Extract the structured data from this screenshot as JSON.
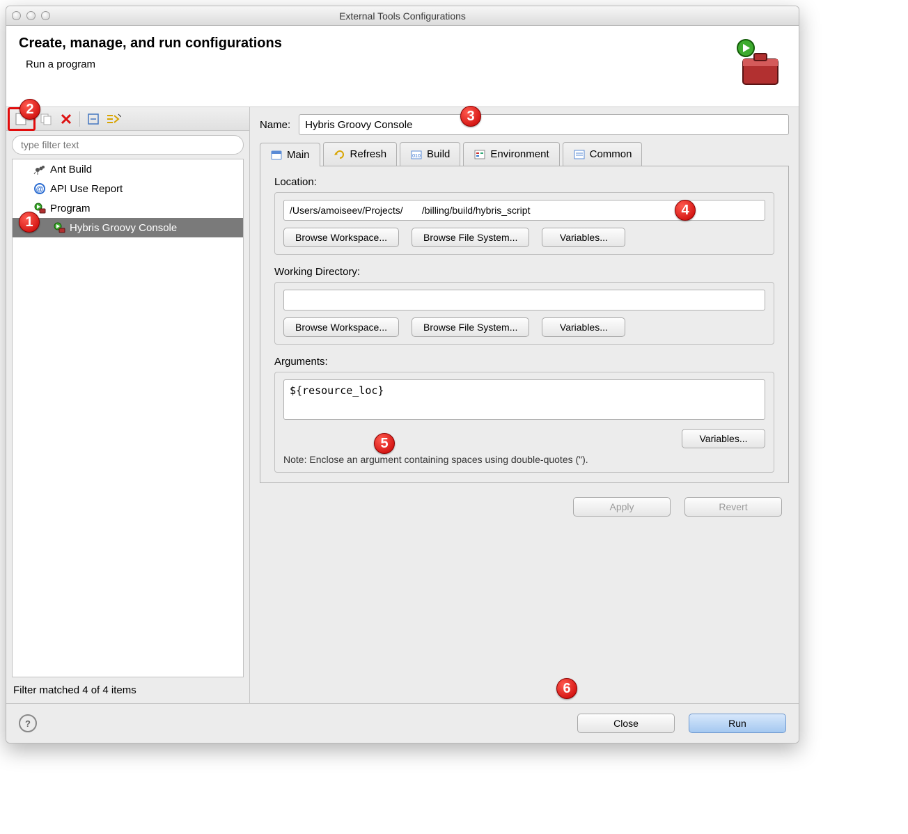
{
  "window": {
    "title": "External Tools Configurations"
  },
  "banner": {
    "heading": "Create, manage, and run configurations",
    "subheading": "Run a program"
  },
  "filter": {
    "placeholder": "type filter text"
  },
  "tree": {
    "items": [
      {
        "label": "Ant Build",
        "icon": "ant"
      },
      {
        "label": "API Use Report",
        "icon": "at"
      },
      {
        "label": "Program",
        "icon": "program",
        "children": [
          {
            "label": "Hybris Groovy Console",
            "icon": "program",
            "selected": true
          }
        ]
      }
    ]
  },
  "filter_status": "Filter matched 4 of 4 items",
  "form": {
    "name_label": "Name:",
    "name_value": "Hybris Groovy Console"
  },
  "tabs": [
    {
      "label": "Main",
      "active": true
    },
    {
      "label": "Refresh"
    },
    {
      "label": "Build"
    },
    {
      "label": "Environment"
    },
    {
      "label": "Common"
    }
  ],
  "main_tab": {
    "location": {
      "label": "Location:",
      "value": "/Users/amoiseev/Projects/       /billing/build/hybris_script",
      "browse_workspace": "Browse Workspace...",
      "browse_fs": "Browse File System...",
      "variables": "Variables..."
    },
    "working_dir": {
      "label": "Working Directory:",
      "value": "",
      "browse_workspace": "Browse Workspace...",
      "browse_fs": "Browse File System...",
      "variables": "Variables..."
    },
    "arguments": {
      "label": "Arguments:",
      "value": "${resource_loc}",
      "variables": "Variables...",
      "note": "Note: Enclose an argument containing spaces using double-quotes (\")."
    }
  },
  "actions": {
    "apply": "Apply",
    "revert": "Revert",
    "close": "Close",
    "run": "Run"
  },
  "annotations": [
    "1",
    "2",
    "3",
    "4",
    "5",
    "6"
  ]
}
